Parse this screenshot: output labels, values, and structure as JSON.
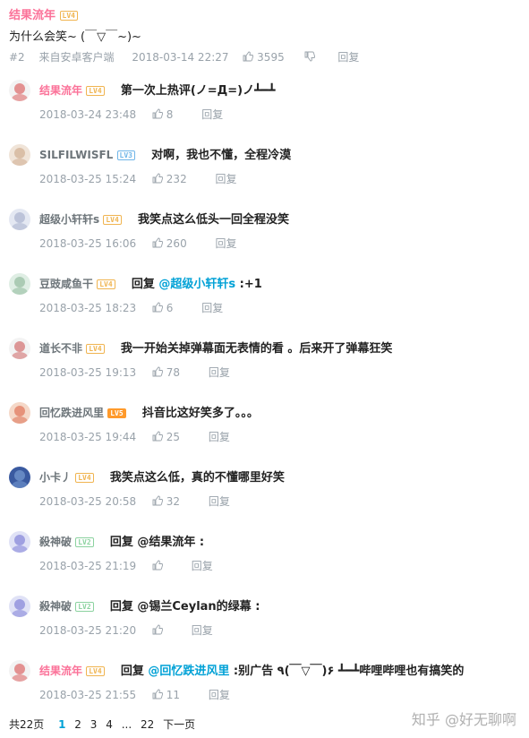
{
  "top_comment": {
    "username": "结果流年",
    "level": "LV4",
    "text": "为什么会笑~ (￣▽￣~)~",
    "floor": "#2",
    "source": "来自安卓客户端",
    "time": "2018-03-14 22:27",
    "likes": "3595",
    "reply_label": "回复"
  },
  "replies": [
    {
      "username": "结果流年",
      "level": "LV4",
      "vip": true,
      "prefix": "",
      "at": "",
      "text": "第一次上热评(ノ=Д=)ノ┻━┻",
      "time": "2018-03-24 23:48",
      "likes": "8",
      "reply_label": "回复"
    },
    {
      "username": "SILFILWISFL",
      "level": "LV3",
      "vip": false,
      "prefix": "",
      "at": "",
      "text": "对啊，我也不懂，全程冷漠",
      "time": "2018-03-25 15:24",
      "likes": "232",
      "reply_label": "回复"
    },
    {
      "username": "超级小轩轩s",
      "level": "LV4",
      "vip": false,
      "prefix": "",
      "at": "",
      "text": "我笑点这么低头一回全程没笑",
      "time": "2018-03-25 16:06",
      "likes": "260",
      "reply_label": "回复"
    },
    {
      "username": "豆豉咸鱼干",
      "level": "LV4",
      "vip": false,
      "prefix": "回复 ",
      "at": "@超级小轩轩s",
      "text": " :+1",
      "time": "2018-03-25 18:23",
      "likes": "6",
      "reply_label": "回复"
    },
    {
      "username": "道长不非",
      "level": "LV4",
      "vip": false,
      "prefix": "",
      "at": "",
      "text": "我一开始关掉弹幕面无表情的看 。后来开了弹幕狂笑",
      "time": "2018-03-25 19:13",
      "likes": "78",
      "reply_label": "回复"
    },
    {
      "username": "回忆跌进风里",
      "level": "LV5",
      "vip": false,
      "prefix": "",
      "at": "",
      "text": "抖音比这好笑多了。。。",
      "time": "2018-03-25 19:44",
      "likes": "25",
      "reply_label": "回复"
    },
    {
      "username": "小卡丿",
      "level": "LV4",
      "vip": false,
      "prefix": "",
      "at": "",
      "text": "我笑点这么低，真的不懂哪里好笑",
      "time": "2018-03-25 20:58",
      "likes": "32",
      "reply_label": "回复"
    },
    {
      "username": "殺神破",
      "level": "LV2",
      "vip": false,
      "prefix": "回复 @结果流年 :",
      "at": "",
      "text": "",
      "time": "2018-03-25 21:19",
      "likes": "",
      "reply_label": "回复"
    },
    {
      "username": "殺神破",
      "level": "LV2",
      "vip": false,
      "prefix": "回复 @锡兰Ceylan的绿幕 :",
      "at": "",
      "text": "",
      "time": "2018-03-25 21:20",
      "likes": "",
      "reply_label": "回复"
    },
    {
      "username": "结果流年",
      "level": "LV4",
      "vip": true,
      "prefix": "回复 ",
      "at": "@回忆跌进风里",
      "text": " :别广告 ٩(￣▽￣)۶ ┻━┻哔哩哔哩也有搞笑的",
      "time": "2018-03-25 21:55",
      "likes": "11",
      "reply_label": "回复"
    }
  ],
  "pager": {
    "total": "共22页",
    "pages": [
      "1",
      "2",
      "3",
      "4",
      "...",
      "22"
    ],
    "current": "1",
    "next": "下一页"
  },
  "watermark": "知乎 @好无聊啊",
  "colors": {
    "vip_name": "#fb7299",
    "link": "#00a1d6",
    "meta": "#99a2aa"
  }
}
